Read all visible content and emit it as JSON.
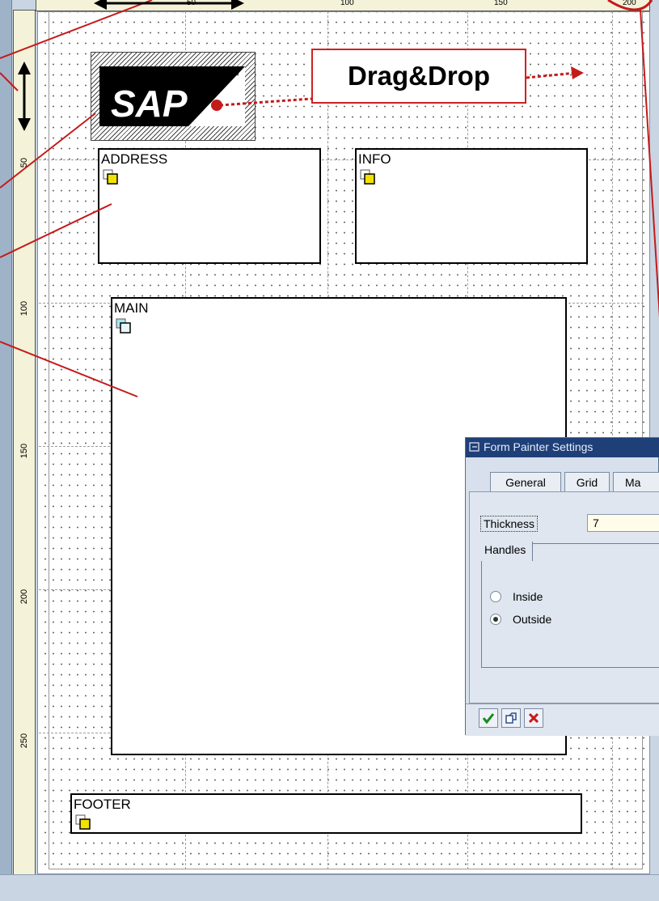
{
  "ruler": {
    "vertical_labels": [
      "50",
      "100",
      "150",
      "200",
      "250"
    ],
    "horizontal_labels": [
      "50",
      "100",
      "150",
      "200"
    ]
  },
  "windows": {
    "address": "ADDRESS",
    "info": "INFO",
    "main": "MAIN",
    "footer": "FOOTER"
  },
  "logo": {
    "small_label": "SAP",
    "brand": "SAP"
  },
  "callout": {
    "text": "Drag&Drop"
  },
  "dialog": {
    "title": "Form Painter Settings",
    "tabs": [
      "General",
      "Grid",
      "Ma"
    ],
    "thickness_label": "Thickness",
    "thickness_value": "7",
    "handles_group": "Handles",
    "options": [
      "Inside",
      "Outside"
    ],
    "selected_option": "Outside"
  },
  "colors": {
    "callout_red": "#d02020",
    "title_bar": "#1f3f78",
    "icon_yellow": "#f2e200",
    "icon_cyan": "#a6e6ee"
  },
  "icons": {
    "window_types": [
      "secondary-window-icon",
      "main-window-icon"
    ],
    "dialog_buttons": [
      "check-icon",
      "copy-icon",
      "cancel-icon"
    ]
  }
}
